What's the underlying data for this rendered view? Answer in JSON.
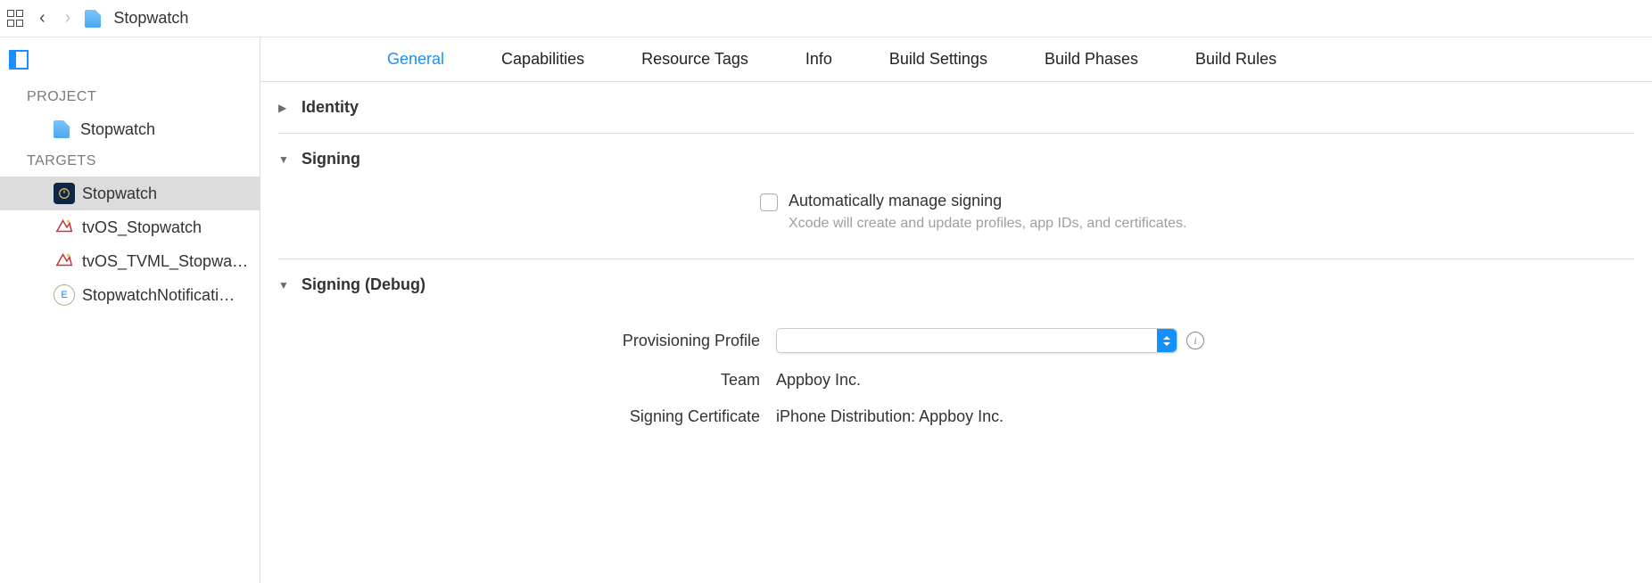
{
  "breadcrumb": {
    "title": "Stopwatch"
  },
  "sidebar": {
    "project_section": "PROJECT",
    "targets_section": "TARGETS",
    "project_item": "Stopwatch",
    "targets": [
      {
        "label": "Stopwatch",
        "icon": "app",
        "selected": true
      },
      {
        "label": "tvOS_Stopwatch",
        "icon": "tv",
        "selected": false
      },
      {
        "label": "tvOS_TVML_Stopwa…",
        "icon": "tv",
        "selected": false
      },
      {
        "label": "StopwatchNotificati…",
        "icon": "ext",
        "selected": false
      }
    ]
  },
  "tabs": {
    "items": [
      "General",
      "Capabilities",
      "Resource Tags",
      "Info",
      "Build Settings",
      "Build Phases",
      "Build Rules"
    ],
    "active": "General"
  },
  "sections": {
    "identity": "Identity",
    "signing": "Signing",
    "signing_debug": "Signing (Debug)"
  },
  "signing": {
    "auto_label": "Automatically manage signing",
    "auto_desc": "Xcode will create and update profiles, app IDs, and certificates.",
    "auto_checked": false
  },
  "signing_debug": {
    "profile_label": "Provisioning Profile",
    "profile_value": "",
    "team_label": "Team",
    "team_value": "Appboy Inc.",
    "cert_label": "Signing Certificate",
    "cert_value": "iPhone Distribution: Appboy Inc."
  }
}
